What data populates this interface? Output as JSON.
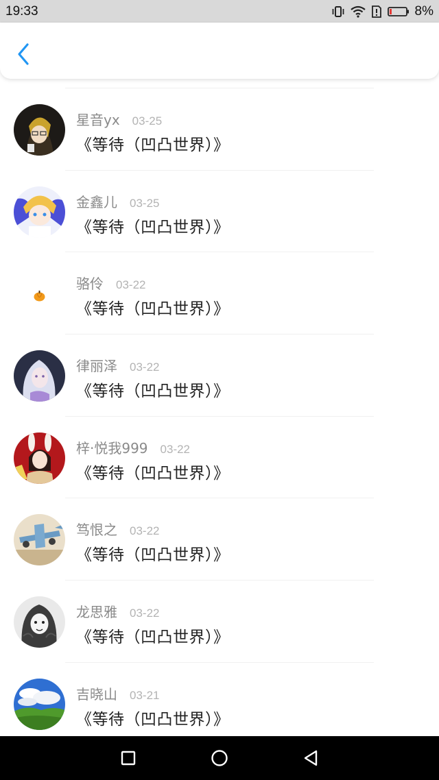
{
  "status_bar": {
    "time": "19:33",
    "battery": "8%"
  },
  "header": {
    "back_icon": "chevron-left-icon",
    "accent": "#2196F3"
  },
  "items": [
    {
      "username": "星音yx",
      "date": "03-25",
      "title": "《等待（凹凸世界）》",
      "avatar_desc": "dark-anime-avatar"
    },
    {
      "username": "金鑫儿",
      "date": "03-25",
      "title": "《等待（凹凸世界）》",
      "avatar_desc": "blonde-anime-avatar"
    },
    {
      "username": "骆伶",
      "date": "03-22",
      "title": "《等待（凹凸世界）》",
      "avatar_desc": "pumpkin-avatar"
    },
    {
      "username": "律丽泽",
      "date": "03-22",
      "title": "《等待（凹凸世界）》",
      "avatar_desc": "white-hair-anime-avatar"
    },
    {
      "username": "梓·悦我999",
      "date": "03-22",
      "title": "《等待（凹凸世界）》",
      "avatar_desc": "red-bunny-girl-avatar"
    },
    {
      "username": "笃恨之",
      "date": "03-22",
      "title": "《等待（凹凸世界）》",
      "avatar_desc": "toy-plane-avatar"
    },
    {
      "username": "龙思雅",
      "date": "03-22",
      "title": "《等待（凹凸世界）》",
      "avatar_desc": "sketch-girl-avatar"
    },
    {
      "username": "吉晓山",
      "date": "03-21",
      "title": "《等待（凹凸世界）》",
      "avatar_desc": "landscape-avatar"
    }
  ]
}
